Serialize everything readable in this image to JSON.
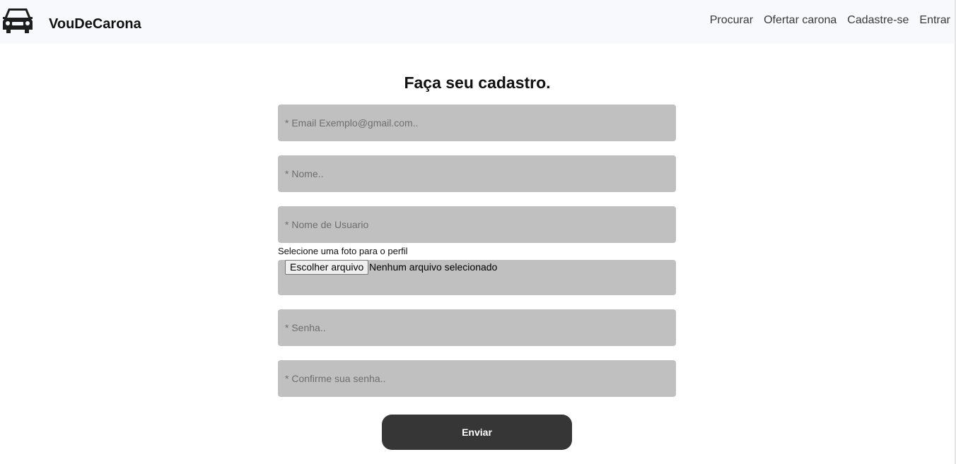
{
  "header": {
    "brand_name": "VouDeCarona",
    "logo_icon": "car-icon",
    "background": "#f8f9fc",
    "nav": [
      {
        "label": "Procurar"
      },
      {
        "label": "Ofertar carona"
      },
      {
        "label": "Cadastre-se"
      },
      {
        "label": "Entrar"
      }
    ]
  },
  "form": {
    "title": "Faça seu cadastro.",
    "email_placeholder": "* Email Exemplo@gmail.com..",
    "name_placeholder": "* Nome..",
    "username_placeholder": "* Nome de Usuario",
    "photo_label": "Selecione uma foto para o perfil",
    "file_button_label": "Escolher arquivo",
    "file_status": "Nenhum arquivo selecionado",
    "password_placeholder": "* Senha..",
    "confirm_password_placeholder": "* Confirme sua senha..",
    "submit_label": "Enviar",
    "field_color": "#c0c0c0",
    "button_color": "#363636"
  }
}
